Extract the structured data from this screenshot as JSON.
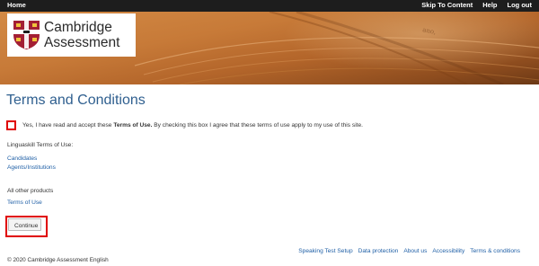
{
  "topnav": {
    "home": "Home",
    "links": [
      "Skip To Content",
      "Help",
      "Log out"
    ]
  },
  "logo": {
    "line1": "Cambridge",
    "line2": "Assessment"
  },
  "banner": {
    "book_text": "ano,"
  },
  "main": {
    "title": "Terms and Conditions",
    "accept_prefix": "Yes, I have read and accept these ",
    "accept_bold": "Terms of Use.",
    "accept_suffix": " By checking this box I agree that these terms of use apply to my use of this site.",
    "linguaskill_label": "Linguaskill Terms of Use:",
    "candidates_link": "Candidates",
    "agents_link": "Agents/Institutions",
    "other_label": "All other products",
    "terms_link": "Terms of Use",
    "continue_button": "Continue"
  },
  "footer": {
    "links": [
      "Speaking Test Setup",
      "Data protection",
      "About us",
      "Accessibility",
      "Terms & conditions"
    ],
    "copyright": "© 2020 Cambridge Assessment English"
  },
  "colors": {
    "topbar": "#1d1d1d",
    "title": "#2f5f8f",
    "link": "#1f5fa6",
    "highlight": "#e00000",
    "shield": "#a31f34"
  },
  "icons": {
    "logo": "cambridge-shield-icon"
  }
}
